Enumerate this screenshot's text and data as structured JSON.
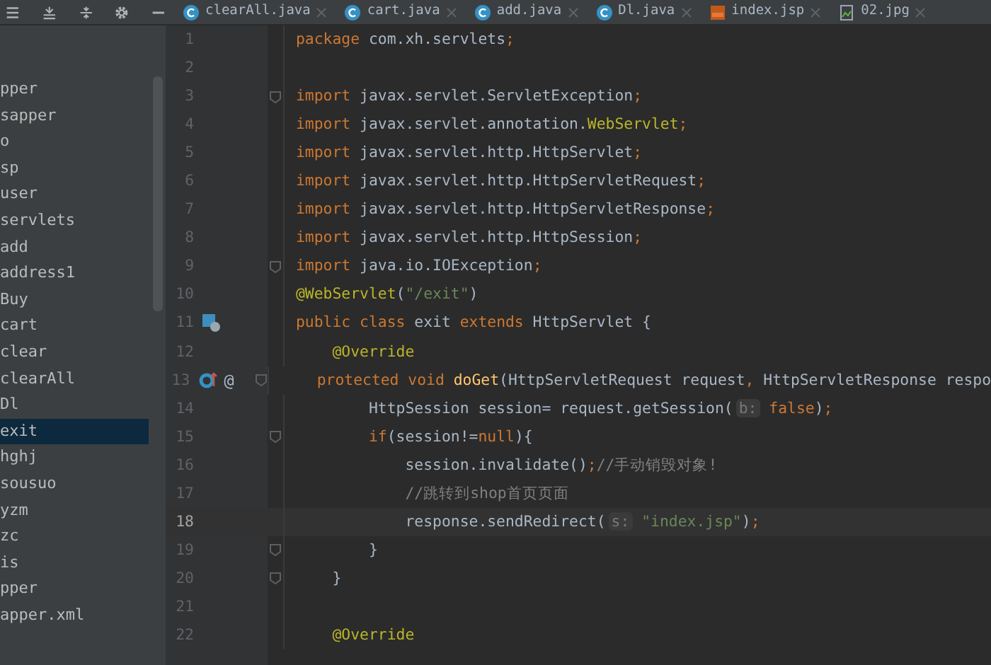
{
  "tabs": [
    {
      "label": "clearAll.java",
      "kind": "java",
      "selected": false
    },
    {
      "label": "cart.java",
      "kind": "java",
      "selected": false
    },
    {
      "label": "add.java",
      "kind": "java",
      "selected": false
    },
    {
      "label": "Dl.java",
      "kind": "java",
      "selected": false
    },
    {
      "label": "index.jsp",
      "kind": "jsp",
      "selected": false
    },
    {
      "label": "02.jpg",
      "kind": "image",
      "selected": false
    }
  ],
  "project_tree": {
    "items": [
      {
        "label": "pper",
        "selected": false
      },
      {
        "label": "sapper",
        "selected": false
      },
      {
        "label": "o",
        "selected": false
      },
      {
        "label": "sp",
        "selected": false
      },
      {
        "label": "user",
        "selected": false
      },
      {
        "label": "servlets",
        "selected": false
      },
      {
        "label": "add",
        "selected": false
      },
      {
        "label": "address1",
        "selected": false
      },
      {
        "label": "Buy",
        "selected": false
      },
      {
        "label": "cart",
        "selected": false
      },
      {
        "label": "clear",
        "selected": false
      },
      {
        "label": "clearAll",
        "selected": false
      },
      {
        "label": "Dl",
        "selected": false
      },
      {
        "label": "exit",
        "selected": true
      },
      {
        "label": "hghj",
        "selected": false
      },
      {
        "label": "sousuo",
        "selected": false
      },
      {
        "label": "yzm",
        "selected": false
      },
      {
        "label": "zc",
        "selected": false
      },
      {
        "label": "is",
        "selected": false
      },
      {
        "label": "pper",
        "selected": false
      },
      {
        "label": "apper.xml",
        "selected": false
      }
    ]
  },
  "editor": {
    "lines": [
      {
        "number": "1",
        "current": false,
        "fold": false,
        "tokens": [
          {
            "kind": "kw",
            "text": "package"
          },
          {
            "kind": "txt",
            "text": " com.xh.servlets"
          },
          {
            "kind": "kw",
            "text": ";"
          }
        ]
      },
      {
        "number": "2",
        "current": false,
        "fold": false
      },
      {
        "number": "3",
        "current": false,
        "fold": true,
        "tokens": [
          {
            "kind": "kw",
            "text": "import"
          },
          {
            "kind": "txt",
            "text": " javax.servlet.ServletException"
          },
          {
            "kind": "kw",
            "text": ";"
          }
        ]
      },
      {
        "number": "4",
        "current": false,
        "fold": false,
        "tokens": [
          {
            "kind": "kw",
            "text": "import"
          },
          {
            "kind": "txt",
            "text": " javax.servlet.annotation."
          },
          {
            "kind": "ann",
            "text": "WebServlet"
          },
          {
            "kind": "kw",
            "text": ";"
          }
        ]
      },
      {
        "number": "5",
        "current": false,
        "fold": false,
        "tokens": [
          {
            "kind": "kw",
            "text": "import"
          },
          {
            "kind": "txt",
            "text": " javax.servlet.http.HttpServlet"
          },
          {
            "kind": "kw",
            "text": ";"
          }
        ]
      },
      {
        "number": "6",
        "current": false,
        "fold": false,
        "tokens": [
          {
            "kind": "kw",
            "text": "import"
          },
          {
            "kind": "txt",
            "text": " javax.servlet.http.HttpServletRequest"
          },
          {
            "kind": "kw",
            "text": ";"
          }
        ]
      },
      {
        "number": "7",
        "current": false,
        "fold": false,
        "tokens": [
          {
            "kind": "kw",
            "text": "import"
          },
          {
            "kind": "txt",
            "text": " javax.servlet.http.HttpServletResponse"
          },
          {
            "kind": "kw",
            "text": ";"
          }
        ]
      },
      {
        "number": "8",
        "current": false,
        "fold": false,
        "tokens": [
          {
            "kind": "kw",
            "text": "import"
          },
          {
            "kind": "txt",
            "text": " javax.servlet.http.HttpSession"
          },
          {
            "kind": "kw",
            "text": ";"
          }
        ]
      },
      {
        "number": "9",
        "current": false,
        "fold": true,
        "tokens": [
          {
            "kind": "kw",
            "text": "import"
          },
          {
            "kind": "txt",
            "text": " java.io.IOException"
          },
          {
            "kind": "kw",
            "text": ";"
          }
        ]
      },
      {
        "number": "10",
        "current": false,
        "fold": false,
        "tokens": [
          {
            "kind": "ann",
            "text": "@WebServlet"
          },
          {
            "kind": "txt",
            "text": "("
          },
          {
            "kind": "str",
            "text": "\"/exit\""
          },
          {
            "kind": "txt",
            "text": ")"
          }
        ]
      },
      {
        "number": "11",
        "current": false,
        "fold": false,
        "gutter_icons": [
          {
            "kind": "class"
          }
        ],
        "tokens": [
          {
            "kind": "kw",
            "text": "public class"
          },
          {
            "kind": "txt",
            "text": " exit "
          },
          {
            "kind": "kw",
            "text": "extends"
          },
          {
            "kind": "txt",
            "text": " HttpServlet {"
          }
        ]
      },
      {
        "number": "12",
        "current": false,
        "fold": false,
        "tokens": [
          {
            "kind": "ann",
            "text": "    @Override"
          }
        ]
      },
      {
        "number": "13",
        "current": false,
        "fold": true,
        "gutter_icons": [
          {
            "kind": "override"
          }
        ],
        "gutter_text": "@",
        "tokens": [
          {
            "kind": "kw",
            "text": "    protected void"
          },
          {
            "kind": "fn",
            "text": " doGet"
          },
          {
            "kind": "txt",
            "text": "(HttpServletRequest request"
          },
          {
            "kind": "kw",
            "text": ","
          },
          {
            "kind": "txt",
            "text": " HttpServletResponse respo"
          }
        ]
      },
      {
        "number": "14",
        "current": false,
        "fold": false,
        "tokens": [
          {
            "kind": "txt",
            "text": "        HttpSession session= request.getSession("
          },
          {
            "kind": "hint",
            "text": "b:"
          },
          {
            "kind": "kw",
            "text": " false"
          },
          {
            "kind": "txt",
            "text": ")"
          },
          {
            "kind": "kw",
            "text": ";"
          }
        ]
      },
      {
        "number": "15",
        "current": false,
        "fold": true,
        "tokens": [
          {
            "kind": "kw",
            "text": "        if"
          },
          {
            "kind": "txt",
            "text": "(session!="
          },
          {
            "kind": "kw",
            "text": "null"
          },
          {
            "kind": "txt",
            "text": "){"
          }
        ]
      },
      {
        "number": "16",
        "current": false,
        "fold": false,
        "tokens": [
          {
            "kind": "txt",
            "text": "            session.invalidate()"
          },
          {
            "kind": "kw",
            "text": ";"
          },
          {
            "kind": "cmt",
            "text": "//手动销毁对象!"
          }
        ]
      },
      {
        "number": "17",
        "current": false,
        "fold": false,
        "tokens": [
          {
            "kind": "cmt",
            "text": "            //跳转到shop首页页面"
          }
        ]
      },
      {
        "number": "18",
        "current": true,
        "fold": false,
        "tokens": [
          {
            "kind": "txt",
            "text": "            response.sendRedirect("
          },
          {
            "kind": "hint",
            "text": "s:"
          },
          {
            "kind": "str",
            "text": " \"index.jsp\""
          },
          {
            "kind": "txt",
            "text": ")"
          },
          {
            "kind": "kw",
            "text": ";"
          }
        ]
      },
      {
        "number": "19",
        "current": false,
        "fold": true,
        "tokens": [
          {
            "kind": "txt",
            "text": "        }"
          }
        ]
      },
      {
        "number": "20",
        "current": false,
        "fold": true,
        "tokens": [
          {
            "kind": "txt",
            "text": "    }"
          }
        ]
      },
      {
        "number": "21",
        "current": false,
        "fold": false
      },
      {
        "number": "22",
        "current": false,
        "fold": false,
        "tokens": [
          {
            "kind": "ann",
            "text": "    @Override"
          }
        ]
      }
    ]
  }
}
